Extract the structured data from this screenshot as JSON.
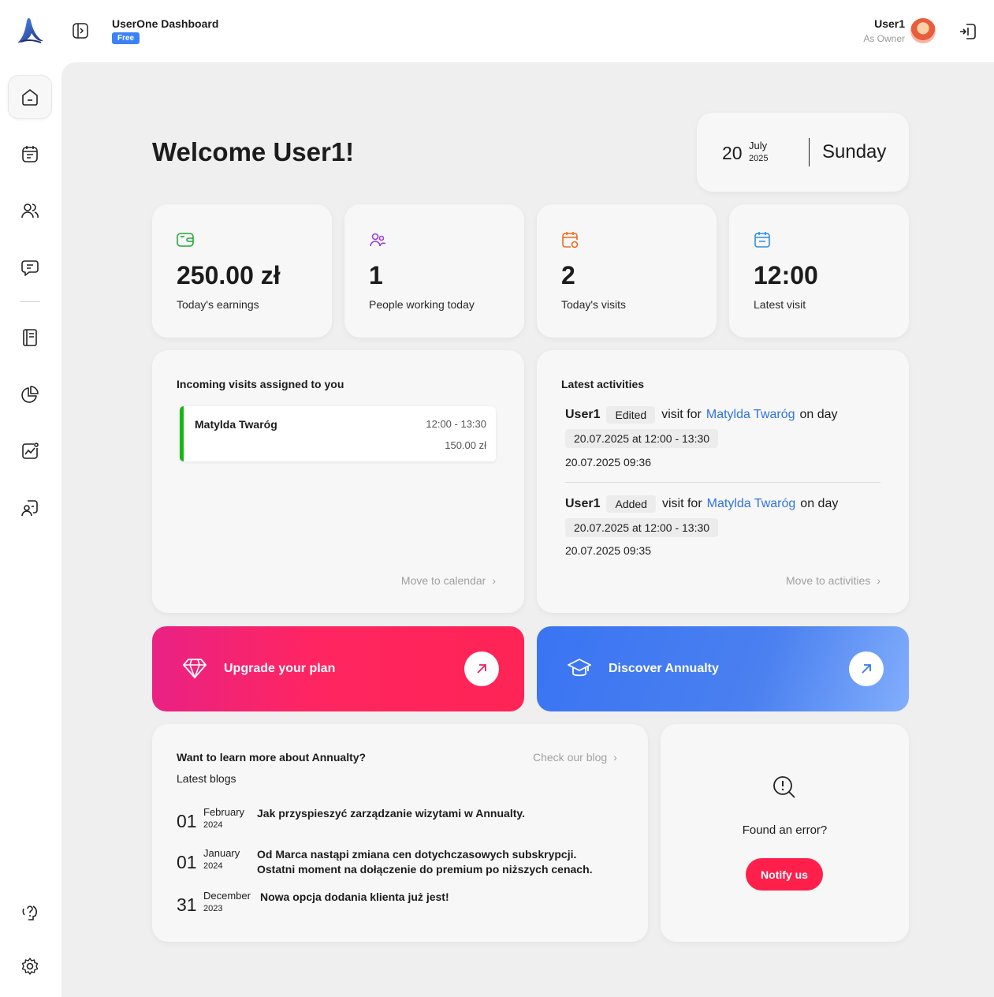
{
  "header": {
    "app_title": "UserOne Dashboard",
    "plan_badge": "Free",
    "user_name": "User1",
    "user_role": "As Owner"
  },
  "sidebar": {
    "items": [
      {
        "name": "home",
        "icon": "home-icon",
        "active": true
      },
      {
        "name": "calendar",
        "icon": "calendar-icon"
      },
      {
        "name": "clients",
        "icon": "users-icon"
      },
      {
        "name": "messages",
        "icon": "message-icon"
      },
      {
        "name": "services",
        "icon": "book-icon"
      },
      {
        "name": "reports",
        "icon": "pie-chart-icon"
      },
      {
        "name": "statistics",
        "icon": "trend-icon"
      },
      {
        "name": "employees",
        "icon": "employee-icon"
      }
    ],
    "bottom": [
      {
        "name": "help",
        "icon": "help-icon"
      },
      {
        "name": "settings",
        "icon": "gear-icon"
      }
    ]
  },
  "welcome": "Welcome User1!",
  "date": {
    "day": "20",
    "month": "July",
    "year": "2025",
    "weekday": "Sunday"
  },
  "stats": [
    {
      "value": "250.00 zł",
      "label": "Today's earnings",
      "icon": "wallet-icon",
      "color": "#22a83a"
    },
    {
      "value": "1",
      "label": "People working today",
      "icon": "people-icon",
      "color": "#9b3fe0"
    },
    {
      "value": "2",
      "label": "Today's visits",
      "icon": "calendar-clock-icon",
      "color": "#f06a1d"
    },
    {
      "value": "12:00",
      "label": "Latest visit",
      "icon": "calendar-icon",
      "color": "#2f8fe0"
    }
  ],
  "visits": {
    "title": "Incoming visits assigned to you",
    "items": [
      {
        "name": "Matylda Twaróg",
        "time": "12:00 - 13:30",
        "price": "150.00 zł"
      }
    ],
    "move_link": "Move to calendar"
  },
  "activities": {
    "title": "Latest activities",
    "items": [
      {
        "user": "User1",
        "action": "Edited",
        "pre": "visit for",
        "client": "Matylda Twaróg",
        "post": "on day",
        "range": "20.07.2025 at 12:00 - 13:30",
        "timestamp": "20.07.2025  09:36"
      },
      {
        "user": "User1",
        "action": "Added",
        "pre": "visit for",
        "client": "Matylda Twaróg",
        "post": "on day",
        "range": "20.07.2025 at 12:00 - 13:30",
        "timestamp": "20.07.2025  09:35"
      }
    ],
    "move_link": "Move to activities"
  },
  "promos": {
    "upgrade": "Upgrade your plan",
    "discover": "Discover Annualty"
  },
  "blog": {
    "title": "Want to learn more about Annualty?",
    "subtitle": "Latest blogs",
    "check_link": "Check our blog",
    "posts": [
      {
        "day": "01",
        "month": "February",
        "year": "2024",
        "text": "Jak przyspieszyć zarządzanie wizytami w Annualty."
      },
      {
        "day": "01",
        "month": "January",
        "year": "2024",
        "text": "Od Marca nastąpi zmiana cen dotychczasowych subskrypcji. Ostatni moment na dołączenie do premium po niższych cenach."
      },
      {
        "day": "31",
        "month": "December",
        "year": "2023",
        "text": "Nowa opcja dodania klienta już jest!"
      }
    ]
  },
  "error": {
    "text": "Found an error?",
    "button": "Notify us"
  }
}
